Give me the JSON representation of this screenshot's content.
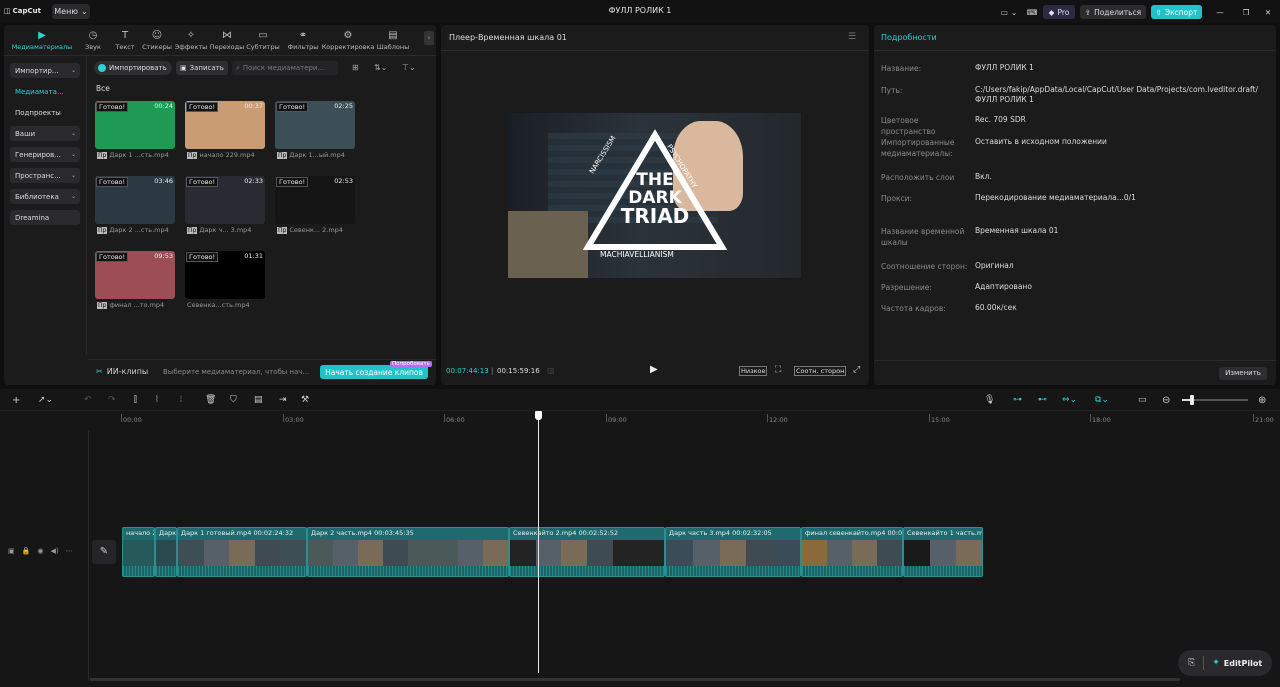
{
  "app": {
    "logo_text": "CapCut",
    "menu_label": "Меню",
    "window_title": "ФУЛЛ РОЛИК 1"
  },
  "topbar": {
    "pro_label": "Pro",
    "share_label": "Поделиться",
    "export_label": "Экспорт"
  },
  "tabs": [
    {
      "label": "Медиаматериалы",
      "icon": "media-icon",
      "active": true
    },
    {
      "label": "Звук",
      "icon": "audio-icon"
    },
    {
      "label": "Текст",
      "icon": "text-icon"
    },
    {
      "label": "Стикеры",
      "icon": "sticker-icon"
    },
    {
      "label": "Эффекты",
      "icon": "effects-icon"
    },
    {
      "label": "Переходы",
      "icon": "transitions-icon"
    },
    {
      "label": "Субтитры",
      "icon": "subtitles-icon"
    },
    {
      "label": "Фильтры",
      "icon": "filters-icon"
    },
    {
      "label": "Корректировка",
      "icon": "adjust-icon"
    },
    {
      "label": "Шаблоны",
      "icon": "templates-icon"
    }
  ],
  "sidebar": [
    {
      "label": "Импортир...",
      "style": "dropdown"
    },
    {
      "label": "Медиамата...",
      "style": "active"
    },
    {
      "label": "Подпроекты",
      "style": "plain"
    },
    {
      "label": "Ваши",
      "style": "dropdown"
    },
    {
      "label": "Генериров...",
      "style": "dropdown"
    },
    {
      "label": "Пространс...",
      "style": "dropdown"
    },
    {
      "label": "Библиотека",
      "style": "dropdown"
    },
    {
      "label": "Dreamina",
      "style": "button"
    }
  ],
  "media_toolbar": {
    "import_label": "Импортировать",
    "record_label": "Записать",
    "search_placeholder": "Поиск медиаматери...",
    "filter_all": "Все"
  },
  "media_items": [
    {
      "status": "Готово!",
      "duration": "00:24",
      "name": "Дарк 1 ...сть.mp4",
      "color": "#1f9a55"
    },
    {
      "status": "Готово!",
      "duration": "00:37",
      "name": "начало 229.mp4",
      "color": "#c99c74"
    },
    {
      "status": "Готово!",
      "duration": "02:25",
      "name": "Дарк 1...ый.mp4",
      "color": "#3c4f57"
    },
    {
      "status": "Готово!",
      "duration": "03:46",
      "name": "Дарк 2 ...сть.mp4",
      "color": "#2b3a42"
    },
    {
      "status": "Готово!",
      "duration": "02:33",
      "name": "Дарк ч... 3.mp4",
      "color": "#2a2a33"
    },
    {
      "status": "Готово!",
      "duration": "02:53",
      "name": "Севенк... 2.mp4",
      "color": "#151515"
    },
    {
      "status": "Готово!",
      "duration": "09:53",
      "name": "финал ...то.mp4",
      "color": "#9c4d55"
    },
    {
      "status": "Готово!",
      "duration": "01:31",
      "name": "Севенка...сть.mp4",
      "color": "#000000"
    }
  ],
  "ai_clips": {
    "label": "ИИ-клипы",
    "hint": "Выберите медиаматериал, чтобы нач...",
    "button": "Начать создание клипов",
    "badge": "Попробовать"
  },
  "player": {
    "title": "Плеер-Временная шкала 01",
    "current_time": "00:07:44:13",
    "total_time": "00:15:59:16",
    "quality": "Низкое",
    "ratio": "Соотн. сторон"
  },
  "video": {
    "line1": "THE",
    "line2": "DARK",
    "line3": "TRIAD",
    "left_word": "NARCISSISM",
    "right_word": "PSYCHOPATHY",
    "bottom_word": "MACHIAVELLIANISM"
  },
  "details": {
    "header": "Подробности",
    "rows": [
      {
        "label": "Название:",
        "value": "ФУЛЛ РОЛИК 1"
      },
      {
        "label": "Путь:",
        "value": "C:/Users/fakip/AppData/Local/CapCut/User Data/Projects/com.lveditor.draft/ФУЛЛ РОЛИК 1"
      },
      {
        "label": "Цветовое пространство",
        "value": "Rec. 709 SDR"
      },
      {
        "label": "Импортированные медиаматериалы:",
        "value": "Оставить в исходном положении"
      },
      {
        "label": "Расположить слои",
        "value": "Вкл."
      },
      {
        "label": "Прокси:",
        "value": "Перекодирование медиаматериала...0/1"
      },
      {
        "label": "Название временной шкалы",
        "value": "Временная шкала 01"
      },
      {
        "label": "Соотношение сторон:",
        "value": "Оригинал"
      },
      {
        "label": "Разрешение:",
        "value": "Адаптировано"
      },
      {
        "label": "Частота кадров:",
        "value": "60.00к/сек"
      }
    ],
    "edit_button": "Изменить"
  },
  "ruler": [
    "00:00",
    "03:00",
    "06:00",
    "09:00",
    "12:00",
    "15:00",
    "18:00",
    "21:00"
  ],
  "clips": [
    {
      "name": "начало 2",
      "color": "#26595a"
    },
    {
      "name": "Дарк",
      "color": "#2b4a4f"
    },
    {
      "name": "Дарк 1 готовый.mp4   00:02:24:32",
      "color": "#3d4e55"
    },
    {
      "name": "Дарк 2 часть.mp4   00:03:45:35",
      "color": "#4a5a58"
    },
    {
      "name": "Севенкайто 2.mp4   00:02:52:52",
      "color": "#232323"
    },
    {
      "name": "Дарк часть 3.mp4   00:02:32:05",
      "color": "#3a4c58"
    },
    {
      "name": "финал севенкайто.mp4   00:0",
      "color": "#8a6a3a"
    },
    {
      "name": "Севенкайто 1 часть.mp4",
      "color": "#1a1a1a"
    }
  ],
  "editpilot": {
    "label": "EditPilot"
  }
}
